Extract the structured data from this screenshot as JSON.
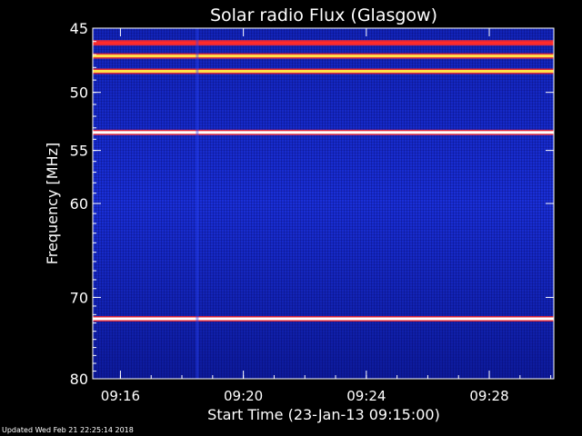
{
  "chart_data": {
    "type": "heatmap",
    "title": "Solar radio Flux (Glasgow)",
    "xlabel": "Start Time (23-Jan-13 09:15:00)",
    "ylabel": "Frequency [MHz]",
    "x_unit": "time",
    "x_start": "09:15:00",
    "xlim": [
      "09:15:06",
      "09:30:06"
    ],
    "x_ticks": [
      "09:16",
      "09:20",
      "09:24",
      "09:28"
    ],
    "ylim": [
      45,
      80
    ],
    "y_ticks": [
      45,
      50,
      55,
      60,
      70,
      80
    ],
    "y_scale": "log",
    "colormap": [
      "#0a0a6e",
      "#1a2bd4",
      "#ff2a2a",
      "#ffe14a",
      "#ffffff"
    ],
    "background_level": 0.3,
    "bands": [
      {
        "freq": 46.1,
        "intensity": 0.55
      },
      {
        "freq": 47.1,
        "intensity": 0.7
      },
      {
        "freq": 48.3,
        "intensity": 0.85
      },
      {
        "freq": 53.4,
        "intensity": 0.95
      },
      {
        "freq": 72.5,
        "intensity": 1.0
      }
    ],
    "time_streaks": [
      {
        "time": "09:18:30",
        "intensity": 0.4
      }
    ]
  },
  "footer": {
    "updated": "Updated Wed Feb 21 22:25:14 2018"
  }
}
